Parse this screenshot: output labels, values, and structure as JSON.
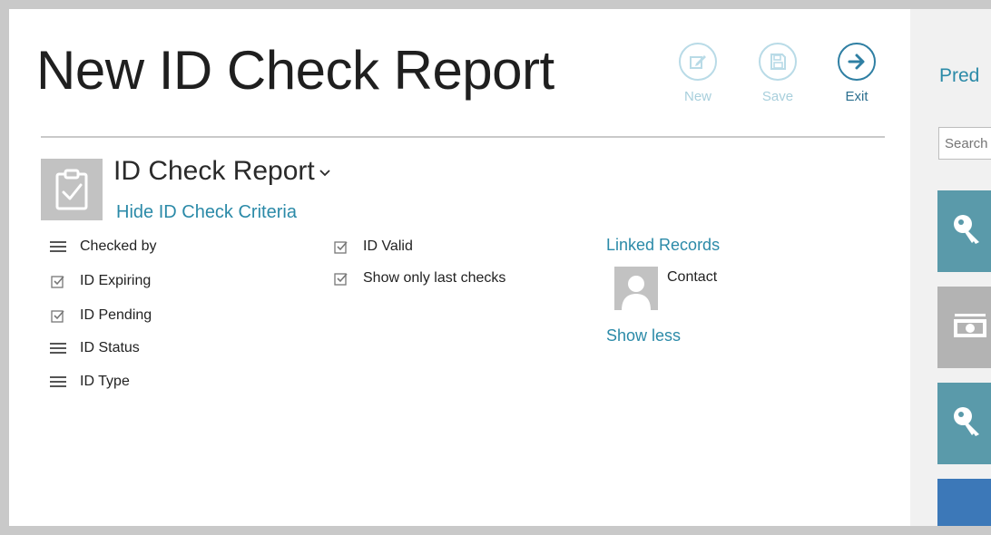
{
  "header": {
    "title": "New ID Check Report",
    "commands": [
      {
        "label": "New",
        "icon": "edit-icon",
        "enabled": false
      },
      {
        "label": "Save",
        "icon": "save-icon",
        "enabled": false
      },
      {
        "label": "Exit",
        "icon": "arrow-right-icon",
        "enabled": true
      }
    ]
  },
  "report": {
    "name": "ID Check Report",
    "toggle_label": "Hide ID Check Criteria",
    "icon": "clipboard-check-icon"
  },
  "criteria": {
    "column1": [
      {
        "label": "Checked by",
        "icon": "list-icon"
      },
      {
        "label": "ID Expiring",
        "icon": "checkbox-checked-icon"
      },
      {
        "label": "ID Pending",
        "icon": "checkbox-checked-icon"
      },
      {
        "label": "ID Status",
        "icon": "list-icon"
      },
      {
        "label": "ID Type",
        "icon": "list-icon"
      }
    ],
    "column2": [
      {
        "label": "ID Valid",
        "icon": "checkbox-checked-icon"
      },
      {
        "label": "Show only last checks",
        "icon": "checkbox-checked-icon"
      }
    ]
  },
  "linked": {
    "title": "Linked Records",
    "items": [
      {
        "label": "Contact",
        "icon": "person-avatar-icon"
      }
    ],
    "show_less": "Show less"
  },
  "side_panel": {
    "title": "Pred",
    "search_placeholder": "Search",
    "tiles": [
      {
        "icon": "key-icon",
        "color": "#5a9aaa"
      },
      {
        "icon": "money-icon",
        "color": "#b3b3b3"
      },
      {
        "icon": "key-icon",
        "color": "#5a9aaa"
      },
      {
        "icon": "home-icon",
        "color": "#3c78b8"
      }
    ]
  },
  "colors": {
    "accent": "#2b8aa8",
    "disabled_accent": "#a8cfdc",
    "exit_accent": "#2f7fa3"
  }
}
